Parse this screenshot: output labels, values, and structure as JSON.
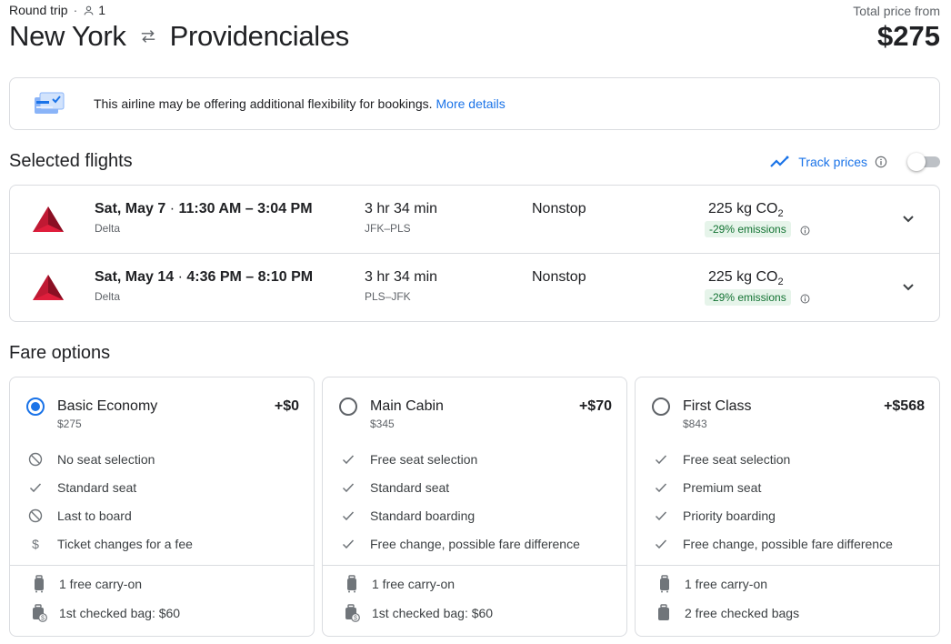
{
  "header": {
    "trip_type": "Round trip",
    "separator": "·",
    "passengers": "1",
    "origin": "New York",
    "destination": "Providenciales",
    "price_label": "Total price from",
    "price": "$275"
  },
  "banner": {
    "text": "This airline may be offering additional flexibility for bookings.",
    "link": "More details"
  },
  "selected_flights": {
    "title": "Selected flights",
    "track_label": "Track prices",
    "flights": [
      {
        "date": "Sat, May 7",
        "sep": "·",
        "times": "11:30 AM – 3:04 PM",
        "airline": "Delta",
        "duration": "3 hr 34 min",
        "codes": "JFK–PLS",
        "stops": "Nonstop",
        "co2_value": "225 kg CO",
        "co2_sub": "2",
        "emissions": "-29% emissions"
      },
      {
        "date": "Sat, May 14",
        "sep": "·",
        "times": "4:36 PM – 8:10 PM",
        "airline": "Delta",
        "duration": "3 hr 34 min",
        "codes": "PLS–JFK",
        "stops": "Nonstop",
        "co2_value": "225 kg CO",
        "co2_sub": "2",
        "emissions": "-29% emissions"
      }
    ]
  },
  "fare_options": {
    "title": "Fare options",
    "fares": [
      {
        "name": "Basic Economy",
        "price": "$275",
        "add": "+$0",
        "selected": true,
        "features": [
          {
            "icon": "no-icon",
            "text": "No seat selection"
          },
          {
            "icon": "check-icon",
            "text": "Standard seat"
          },
          {
            "icon": "no-icon",
            "text": "Last to board"
          },
          {
            "icon": "dollar-icon",
            "text": "Ticket changes for a fee"
          }
        ],
        "bags": [
          {
            "icon": "carry-on-icon",
            "text": "1 free carry-on"
          },
          {
            "icon": "checked-bag-paid-icon",
            "text": "1st checked bag: $60"
          }
        ]
      },
      {
        "name": "Main Cabin",
        "price": "$345",
        "add": "+$70",
        "selected": false,
        "features": [
          {
            "icon": "check-icon",
            "text": "Free seat selection"
          },
          {
            "icon": "check-icon",
            "text": "Standard seat"
          },
          {
            "icon": "check-icon",
            "text": "Standard boarding"
          },
          {
            "icon": "check-icon",
            "text": "Free change, possible fare difference"
          }
        ],
        "bags": [
          {
            "icon": "carry-on-icon",
            "text": "1 free carry-on"
          },
          {
            "icon": "checked-bag-paid-icon",
            "text": "1st checked bag: $60"
          }
        ]
      },
      {
        "name": "First Class",
        "price": "$843",
        "add": "+$568",
        "selected": false,
        "features": [
          {
            "icon": "check-icon",
            "text": "Free seat selection"
          },
          {
            "icon": "check-icon",
            "text": "Premium seat"
          },
          {
            "icon": "check-icon",
            "text": "Priority boarding"
          },
          {
            "icon": "check-icon",
            "text": "Free change, possible fare difference"
          }
        ],
        "bags": [
          {
            "icon": "carry-on-icon",
            "text": "1 free carry-on"
          },
          {
            "icon": "checked-bag-icon",
            "text": "2 free checked bags"
          }
        ]
      }
    ]
  },
  "colors": {
    "accent": "#1a73e8",
    "delta_red": "#c01933",
    "emissions_green": "#137333",
    "emissions_bg": "#e6f4ea",
    "border": "#dadce0"
  }
}
